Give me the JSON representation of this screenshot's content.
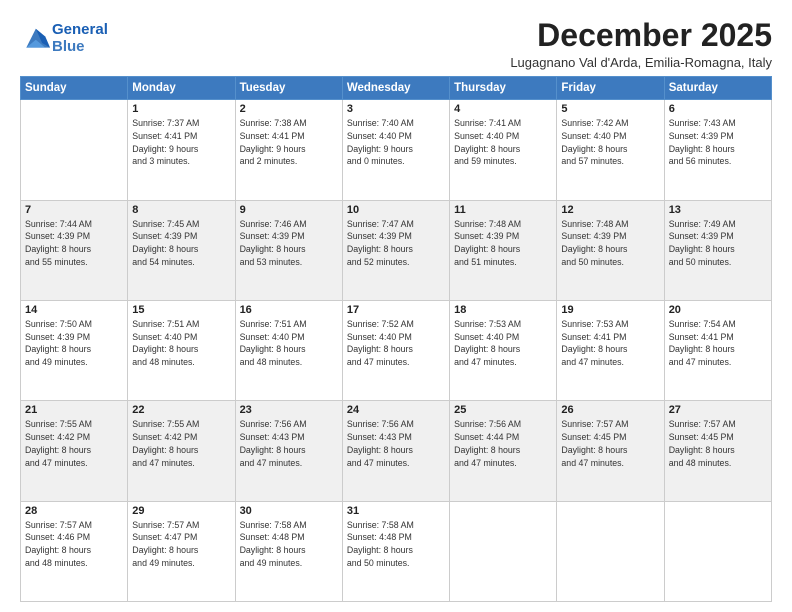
{
  "header": {
    "logo_line1": "General",
    "logo_line2": "Blue",
    "month": "December 2025",
    "location": "Lugagnano Val d'Arda, Emilia-Romagna, Italy"
  },
  "days_of_week": [
    "Sunday",
    "Monday",
    "Tuesday",
    "Wednesday",
    "Thursday",
    "Friday",
    "Saturday"
  ],
  "weeks": [
    [
      {
        "day": "",
        "info": ""
      },
      {
        "day": "1",
        "info": "Sunrise: 7:37 AM\nSunset: 4:41 PM\nDaylight: 9 hours\nand 3 minutes."
      },
      {
        "day": "2",
        "info": "Sunrise: 7:38 AM\nSunset: 4:41 PM\nDaylight: 9 hours\nand 2 minutes."
      },
      {
        "day": "3",
        "info": "Sunrise: 7:40 AM\nSunset: 4:40 PM\nDaylight: 9 hours\nand 0 minutes."
      },
      {
        "day": "4",
        "info": "Sunrise: 7:41 AM\nSunset: 4:40 PM\nDaylight: 8 hours\nand 59 minutes."
      },
      {
        "day": "5",
        "info": "Sunrise: 7:42 AM\nSunset: 4:40 PM\nDaylight: 8 hours\nand 57 minutes."
      },
      {
        "day": "6",
        "info": "Sunrise: 7:43 AM\nSunset: 4:39 PM\nDaylight: 8 hours\nand 56 minutes."
      }
    ],
    [
      {
        "day": "7",
        "info": "Sunrise: 7:44 AM\nSunset: 4:39 PM\nDaylight: 8 hours\nand 55 minutes."
      },
      {
        "day": "8",
        "info": "Sunrise: 7:45 AM\nSunset: 4:39 PM\nDaylight: 8 hours\nand 54 minutes."
      },
      {
        "day": "9",
        "info": "Sunrise: 7:46 AM\nSunset: 4:39 PM\nDaylight: 8 hours\nand 53 minutes."
      },
      {
        "day": "10",
        "info": "Sunrise: 7:47 AM\nSunset: 4:39 PM\nDaylight: 8 hours\nand 52 minutes."
      },
      {
        "day": "11",
        "info": "Sunrise: 7:48 AM\nSunset: 4:39 PM\nDaylight: 8 hours\nand 51 minutes."
      },
      {
        "day": "12",
        "info": "Sunrise: 7:48 AM\nSunset: 4:39 PM\nDaylight: 8 hours\nand 50 minutes."
      },
      {
        "day": "13",
        "info": "Sunrise: 7:49 AM\nSunset: 4:39 PM\nDaylight: 8 hours\nand 50 minutes."
      }
    ],
    [
      {
        "day": "14",
        "info": "Sunrise: 7:50 AM\nSunset: 4:39 PM\nDaylight: 8 hours\nand 49 minutes."
      },
      {
        "day": "15",
        "info": "Sunrise: 7:51 AM\nSunset: 4:40 PM\nDaylight: 8 hours\nand 48 minutes."
      },
      {
        "day": "16",
        "info": "Sunrise: 7:51 AM\nSunset: 4:40 PM\nDaylight: 8 hours\nand 48 minutes."
      },
      {
        "day": "17",
        "info": "Sunrise: 7:52 AM\nSunset: 4:40 PM\nDaylight: 8 hours\nand 47 minutes."
      },
      {
        "day": "18",
        "info": "Sunrise: 7:53 AM\nSunset: 4:40 PM\nDaylight: 8 hours\nand 47 minutes."
      },
      {
        "day": "19",
        "info": "Sunrise: 7:53 AM\nSunset: 4:41 PM\nDaylight: 8 hours\nand 47 minutes."
      },
      {
        "day": "20",
        "info": "Sunrise: 7:54 AM\nSunset: 4:41 PM\nDaylight: 8 hours\nand 47 minutes."
      }
    ],
    [
      {
        "day": "21",
        "info": "Sunrise: 7:55 AM\nSunset: 4:42 PM\nDaylight: 8 hours\nand 47 minutes."
      },
      {
        "day": "22",
        "info": "Sunrise: 7:55 AM\nSunset: 4:42 PM\nDaylight: 8 hours\nand 47 minutes."
      },
      {
        "day": "23",
        "info": "Sunrise: 7:56 AM\nSunset: 4:43 PM\nDaylight: 8 hours\nand 47 minutes."
      },
      {
        "day": "24",
        "info": "Sunrise: 7:56 AM\nSunset: 4:43 PM\nDaylight: 8 hours\nand 47 minutes."
      },
      {
        "day": "25",
        "info": "Sunrise: 7:56 AM\nSunset: 4:44 PM\nDaylight: 8 hours\nand 47 minutes."
      },
      {
        "day": "26",
        "info": "Sunrise: 7:57 AM\nSunset: 4:45 PM\nDaylight: 8 hours\nand 47 minutes."
      },
      {
        "day": "27",
        "info": "Sunrise: 7:57 AM\nSunset: 4:45 PM\nDaylight: 8 hours\nand 48 minutes."
      }
    ],
    [
      {
        "day": "28",
        "info": "Sunrise: 7:57 AM\nSunset: 4:46 PM\nDaylight: 8 hours\nand 48 minutes."
      },
      {
        "day": "29",
        "info": "Sunrise: 7:57 AM\nSunset: 4:47 PM\nDaylight: 8 hours\nand 49 minutes."
      },
      {
        "day": "30",
        "info": "Sunrise: 7:58 AM\nSunset: 4:48 PM\nDaylight: 8 hours\nand 49 minutes."
      },
      {
        "day": "31",
        "info": "Sunrise: 7:58 AM\nSunset: 4:48 PM\nDaylight: 8 hours\nand 50 minutes."
      },
      {
        "day": "",
        "info": ""
      },
      {
        "day": "",
        "info": ""
      },
      {
        "day": "",
        "info": ""
      }
    ]
  ]
}
